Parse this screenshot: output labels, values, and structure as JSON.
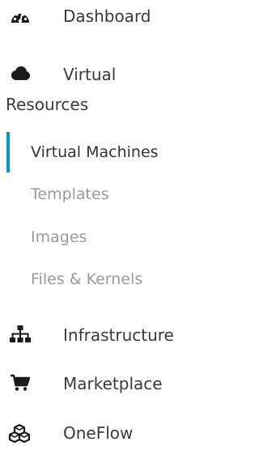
{
  "sidebar": {
    "items": [
      {
        "label": "Dashboard",
        "icon": "dashboard-gauge-icon"
      },
      {
        "label": "Virtual",
        "label_line2": "Resources",
        "icon": "cloud-icon",
        "children": [
          {
            "label": "Virtual Machines",
            "active": true
          },
          {
            "label": "Templates"
          },
          {
            "label": "Images"
          },
          {
            "label": "Files & Kernels"
          }
        ]
      },
      {
        "label": "Infrastructure",
        "icon": "sitemap-icon"
      },
      {
        "label": "Marketplace",
        "icon": "shopping-cart-icon"
      },
      {
        "label": "OneFlow",
        "icon": "cubes-icon"
      }
    ]
  },
  "colors": {
    "active_indicator": "#0098c3",
    "text_main": "#3a3a3a",
    "text_sub": "#9a9a9a",
    "icon": "#1a1a1a"
  }
}
